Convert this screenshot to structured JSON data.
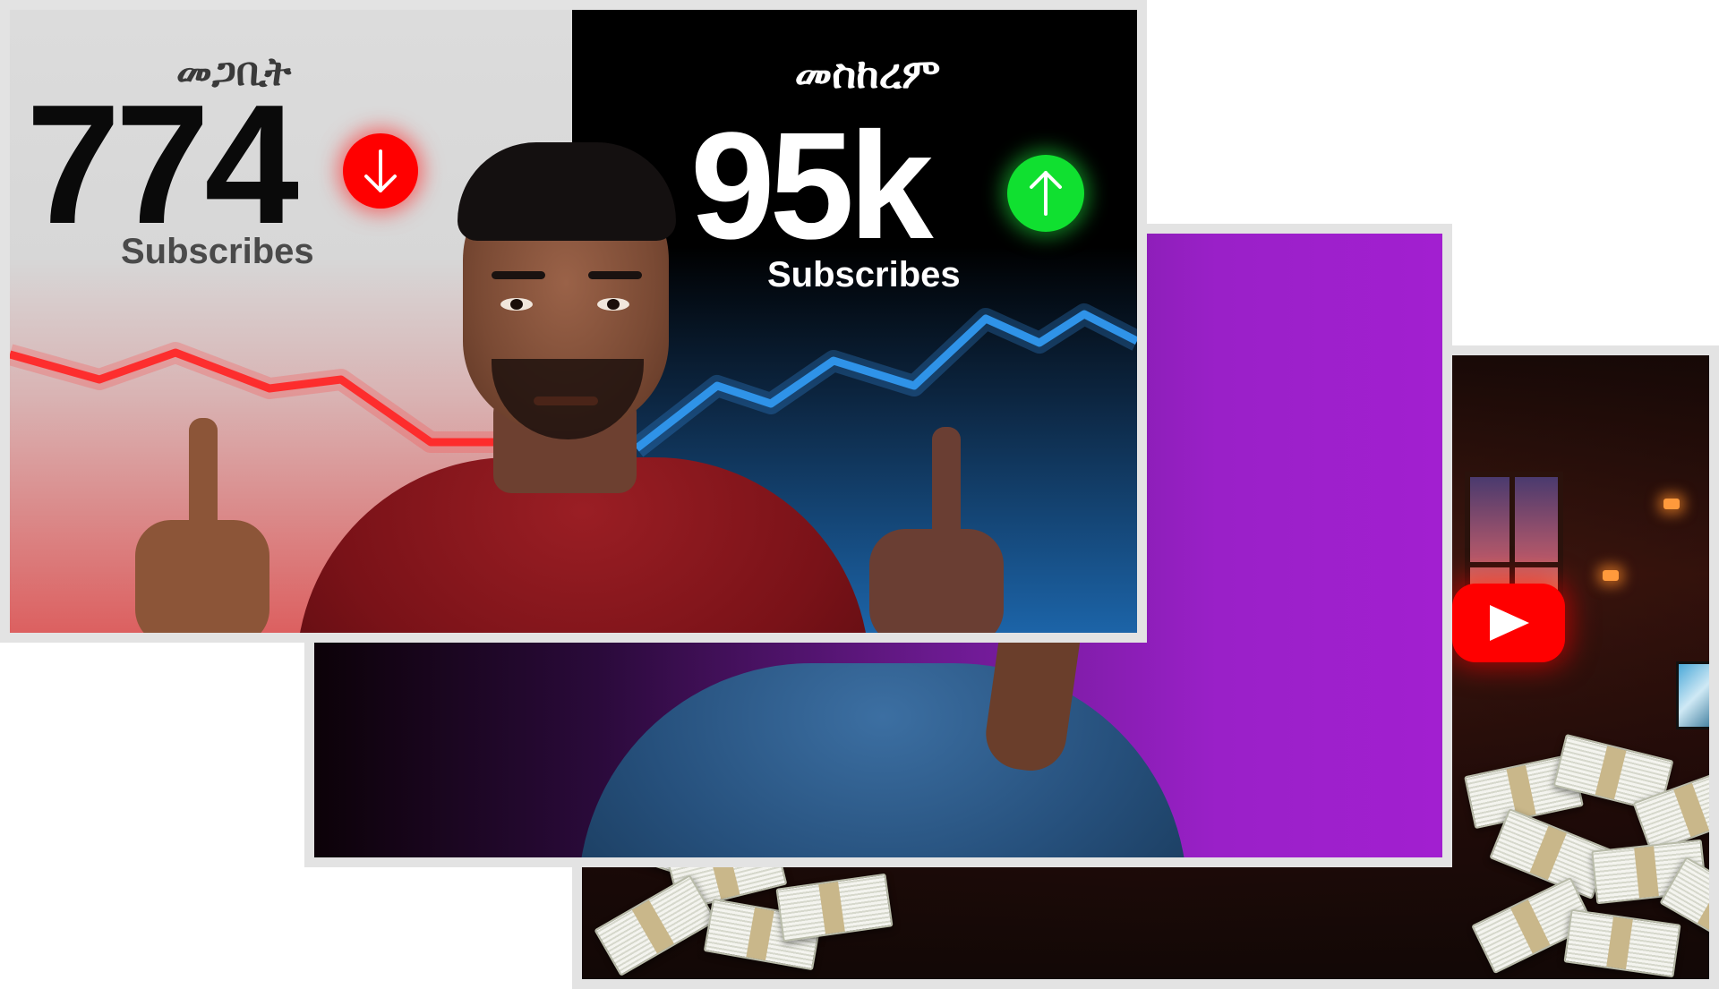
{
  "thumbnails": [
    {
      "position": "front",
      "left_label": "መጋቢት",
      "left_count": "774",
      "left_caption": "Subscribes",
      "left_trend": "down",
      "right_label": "መስከረም",
      "right_count": "95k",
      "right_caption": "Subscribes",
      "right_trend": "up"
    },
    {
      "position": "middle"
    },
    {
      "position": "back"
    }
  ],
  "colors": {
    "down_badge": "#ff0000",
    "up_badge": "#10e030",
    "down_line": "#ff2020",
    "up_line": "#2b8fe0",
    "card_frame": "#e3e3e3",
    "purple_bg": "#a21fd0",
    "youtube_red": "#ff0000"
  },
  "icons": [
    "arrow-down-icon",
    "arrow-up-icon",
    "youtube-play-icon"
  ]
}
